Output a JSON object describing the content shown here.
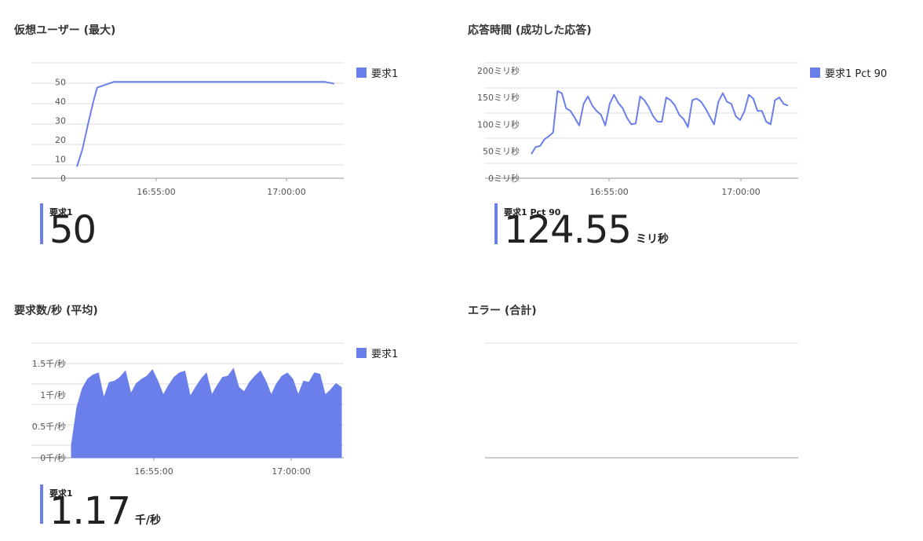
{
  "colors": {
    "series": "#6a7fea",
    "grid": "#dcdcdc",
    "axis": "#999999"
  },
  "panels": [
    {
      "title": "仮想ユーザー (最大)",
      "legend": "要求1",
      "stat_label": "要求1",
      "stat_value": "50",
      "stat_unit": ""
    },
    {
      "title": "応答時間 (成功した応答)",
      "legend": "要求1 Pct 90",
      "stat_label": "要求1 Pct 90",
      "stat_value": "124.55",
      "stat_unit": "ミリ秒"
    },
    {
      "title": "要求数/秒 (平均)",
      "legend": "要求1",
      "stat_label": "要求1",
      "stat_value": "1.17",
      "stat_unit": "千/秒"
    },
    {
      "title": "エラー (合計)"
    }
  ],
  "chart_data": [
    {
      "type": "line",
      "title": "仮想ユーザー (最大)",
      "x_ticks": [
        "16:55:00",
        "17:00:00"
      ],
      "y_ticks": [
        "0",
        "10",
        "20",
        "30",
        "40",
        "50"
      ],
      "ylim": [
        0,
        55
      ],
      "x_minutes": [
        0,
        0.3,
        0.6,
        0.9,
        1.1,
        2,
        4,
        6,
        8,
        10,
        12,
        13.5,
        14
      ],
      "series": [
        {
          "name": "要求1",
          "values": [
            6,
            15,
            28,
            40,
            47,
            50,
            50,
            50,
            50,
            50,
            50,
            50,
            49
          ]
        }
      ]
    },
    {
      "type": "line",
      "title": "応答時間 (成功した応答)",
      "x_ticks": [
        "16:55:00",
        "17:00:00"
      ],
      "y_ticks": [
        "0ミリ秒",
        "50ミリ秒",
        "100ミリ秒",
        "150ミリ秒",
        "200ミリ秒"
      ],
      "ylim": [
        0,
        210
      ],
      "series": [
        {
          "name": "要求1 Pct 90",
          "values": [
            45,
            58,
            60,
            72,
            78,
            85,
            162,
            158,
            130,
            125,
            112,
            98,
            138,
            152,
            135,
            125,
            118,
            98,
            138,
            155,
            140,
            130,
            112,
            100,
            102,
            152,
            145,
            132,
            115,
            105,
            105,
            150,
            145,
            135,
            118,
            110,
            95,
            145,
            148,
            142,
            130,
            115,
            100,
            142,
            158,
            142,
            138,
            115,
            108,
            125,
            155,
            148,
            125,
            125,
            105,
            100,
            145,
            150,
            138,
            135
          ]
        }
      ]
    },
    {
      "type": "area",
      "title": "要求数/秒 (平均)",
      "x_ticks": [
        "16:55:00",
        "17:00:00"
      ],
      "y_ticks": [
        "0千/秒",
        "0.5千/秒",
        "1千/秒",
        "1.5千/秒"
      ],
      "ylim": [
        0,
        1.8
      ],
      "series": [
        {
          "name": "要求1",
          "values": [
            0.2,
            0.8,
            1.1,
            1.25,
            1.32,
            1.35,
            0.95,
            1.2,
            1.22,
            1.28,
            1.38,
            1.02,
            1.18,
            1.25,
            1.3,
            1.4,
            1.22,
            1.0,
            1.15,
            1.28,
            1.35,
            1.38,
            0.98,
            1.12,
            1.25,
            1.35,
            1.0,
            1.15,
            1.28,
            1.3,
            1.42,
            1.12,
            1.05,
            1.2,
            1.3,
            1.38,
            1.22,
            1.0,
            1.18,
            1.3,
            1.35,
            1.25,
            1.0,
            1.22,
            1.2,
            1.35,
            1.33,
            1.0,
            1.08,
            1.18,
            1.12
          ]
        }
      ]
    },
    {
      "type": "line",
      "title": "エラー (合計)",
      "series": []
    }
  ]
}
